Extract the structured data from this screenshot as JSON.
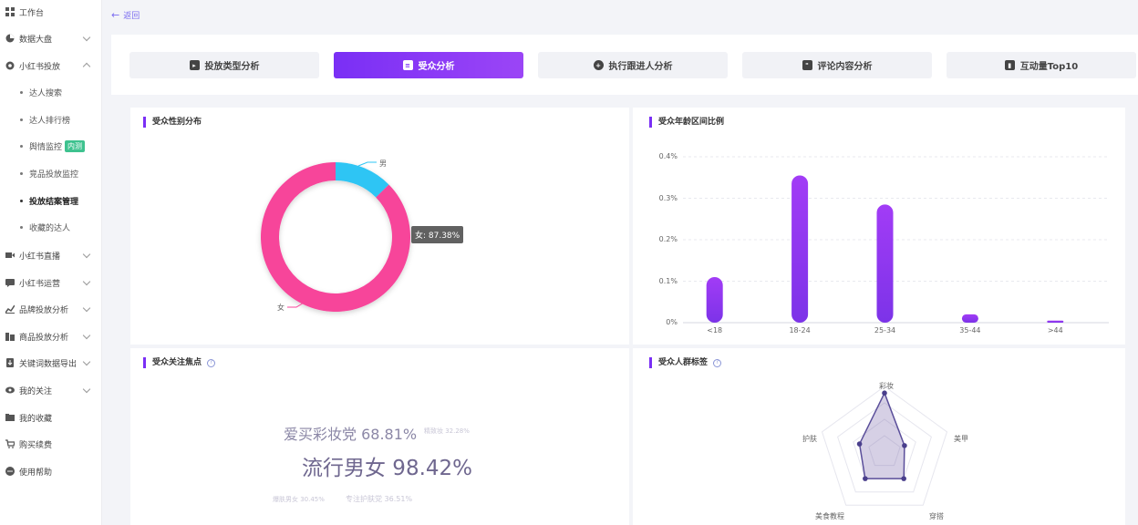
{
  "sidebar": {
    "items": [
      {
        "label": "工作台",
        "icon": "grid-icon"
      },
      {
        "label": "数据大盘",
        "icon": "pie-icon",
        "chevron": "down"
      },
      {
        "label": "小红书投放",
        "icon": "gear-icon",
        "chevron": "up"
      },
      {
        "label": "小红书直播",
        "icon": "video-icon",
        "chevron": "down"
      },
      {
        "label": "小红书运营",
        "icon": "chat-icon",
        "chevron": "down"
      },
      {
        "label": "品牌投放分析",
        "icon": "chart-icon",
        "chevron": "down"
      },
      {
        "label": "商品投放分析",
        "icon": "goods-icon",
        "chevron": "down"
      },
      {
        "label": "关键词数据导出",
        "icon": "export-icon",
        "chevron": "down"
      },
      {
        "label": "我的关注",
        "icon": "eye-icon",
        "chevron": "down"
      },
      {
        "label": "我的收藏",
        "icon": "folder-icon"
      },
      {
        "label": "购买续费",
        "icon": "cart-icon"
      },
      {
        "label": "使用帮助",
        "icon": "help-icon"
      }
    ],
    "subitems": [
      {
        "label": "达人搜索"
      },
      {
        "label": "达人排行榜"
      },
      {
        "label": "舆情监控",
        "badge": "内测"
      },
      {
        "label": "竞品投放监控"
      },
      {
        "label": "投放结案管理"
      },
      {
        "label": "收藏的达人"
      }
    ]
  },
  "back_label": "返回",
  "tabs": [
    {
      "label": "投放类型分析",
      "icon": "folder-icon"
    },
    {
      "label": "受众分析",
      "icon": "document-icon",
      "active": true
    },
    {
      "label": "执行跟进人分析",
      "icon": "user-add-icon"
    },
    {
      "label": "评论内容分析",
      "icon": "comment-icon"
    },
    {
      "label": "互动量Top10",
      "icon": "bar-chart-icon"
    }
  ],
  "gender": {
    "title": "受众性别分布",
    "label_male": "男",
    "label_female": "女",
    "tooltip": "女: 87.38%",
    "colors": {
      "female": "#f7449a",
      "male": "#2ec5f4"
    }
  },
  "age": {
    "title": "受众年龄区间比例"
  },
  "focus": {
    "title": "受众关注焦点",
    "words": [
      {
        "text": "爱买彩妆党 68.81%",
        "size": "medium"
      },
      {
        "text": "精致妆 32.28%",
        "size": "tiny"
      },
      {
        "text": "流行男女 98.42%",
        "size": "large"
      },
      {
        "text": "爆肤男女 30.45%",
        "size": "tiny"
      },
      {
        "text": "专注护肤党 36.51%",
        "size": "tiny"
      }
    ]
  },
  "tags": {
    "title": "受众人群标签",
    "axes": [
      "彩妆",
      "美甲",
      "穿搭",
      "美食教程",
      "护肤"
    ],
    "values": [
      0.9,
      0.32,
      0.5,
      0.5,
      0.4
    ]
  },
  "chart_data": [
    {
      "type": "pie",
      "title": "受众性别分布",
      "categories": [
        "女",
        "男"
      ],
      "values": [
        87.38,
        12.62
      ]
    },
    {
      "type": "bar",
      "title": "受众年龄区间比例",
      "categories": [
        "<18",
        "18-24",
        "25-34",
        "35-44",
        ">44"
      ],
      "values": [
        0.11,
        0.355,
        0.285,
        0.02,
        0.005
      ],
      "yticks": [
        "0.4%",
        "0.3%",
        "0.2%",
        "0.1%",
        "0%"
      ],
      "ylim": [
        0,
        0.4
      ],
      "grid": true
    },
    {
      "type": "radar",
      "title": "受众人群标签",
      "categories": [
        "彩妆",
        "美甲",
        "穿搭",
        "美食教程",
        "护肤"
      ],
      "values": [
        0.9,
        0.32,
        0.5,
        0.5,
        0.4
      ]
    }
  ]
}
